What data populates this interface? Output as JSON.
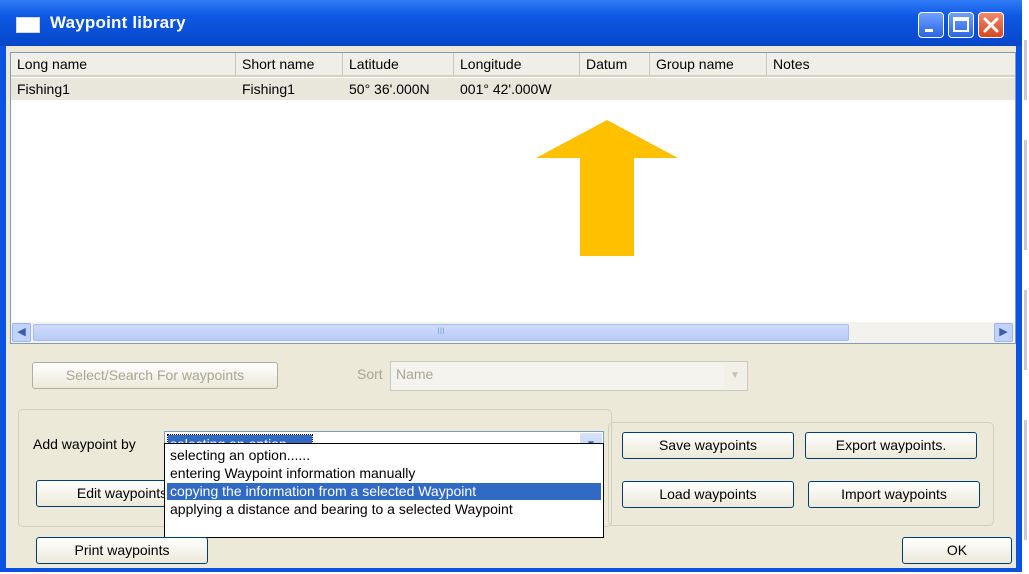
{
  "window": {
    "title": "Waypoint library"
  },
  "columns": [
    "Long name",
    "Short name",
    "Latitude",
    "Longitude",
    "Datum",
    "Group name",
    "Notes"
  ],
  "rows": [
    {
      "long_name": "Fishing1",
      "short_name": "Fishing1",
      "latitude": "50° 36'.000N",
      "longitude": "001° 42'.000W",
      "datum": "",
      "group_name": "",
      "notes": ""
    }
  ],
  "scrollbar": {
    "thumb_grip": "III"
  },
  "search": {
    "button_label": "Select/Search For waypoints",
    "sort_label": "Sort",
    "sort_value": "Name"
  },
  "add": {
    "label": "Add waypoint by",
    "selected": "selecting an option......",
    "options": [
      "selecting an option......",
      "entering Waypoint information manually",
      "copying the information from a selected Waypoint",
      "applying a distance and bearing to a selected Waypoint"
    ],
    "highlighted_index": 2
  },
  "buttons": {
    "edit": "Edit waypoints",
    "print": "Print waypoints",
    "save": "Save waypoints",
    "export": "Export waypoints.",
    "load": "Load waypoints",
    "import": "Import waypoints",
    "ok": "OK"
  },
  "colors": {
    "titlebar": "#0a52e0",
    "arrow": "#ffc000",
    "highlight": "#316ac5"
  },
  "icons": {
    "minimize": "minimize-icon",
    "maximize": "maximize-icon",
    "close": "close-icon",
    "scroll_left": "chevron-left-icon",
    "scroll_right": "chevron-right-icon",
    "dropdown": "chevron-down-icon"
  }
}
